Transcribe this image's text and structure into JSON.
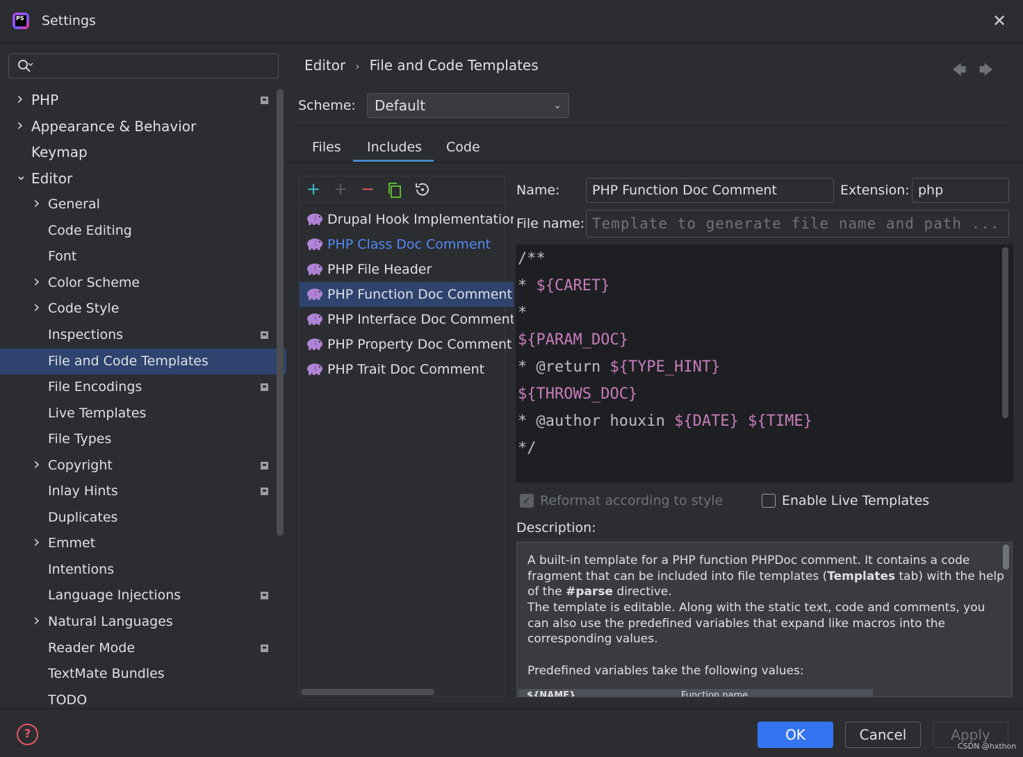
{
  "window": {
    "title": "Settings"
  },
  "search": {
    "placeholder": ""
  },
  "tree": [
    {
      "label": "PHP",
      "level": 0,
      "chevron": "right",
      "badge": true
    },
    {
      "label": "Appearance & Behavior",
      "level": 0,
      "chevron": "right",
      "badge": false
    },
    {
      "label": "Keymap",
      "level": 0,
      "chevron": "",
      "badge": false
    },
    {
      "label": "Editor",
      "level": 0,
      "chevron": "down",
      "badge": false
    },
    {
      "label": "General",
      "level": 1,
      "chevron": "right",
      "badge": false
    },
    {
      "label": "Code Editing",
      "level": 1,
      "chevron": "",
      "badge": false
    },
    {
      "label": "Font",
      "level": 1,
      "chevron": "",
      "badge": false
    },
    {
      "label": "Color Scheme",
      "level": 1,
      "chevron": "right",
      "badge": false
    },
    {
      "label": "Code Style",
      "level": 1,
      "chevron": "right",
      "badge": false
    },
    {
      "label": "Inspections",
      "level": 1,
      "chevron": "",
      "badge": true
    },
    {
      "label": "File and Code Templates",
      "level": 1,
      "chevron": "",
      "badge": false,
      "selected": true
    },
    {
      "label": "File Encodings",
      "level": 1,
      "chevron": "",
      "badge": true
    },
    {
      "label": "Live Templates",
      "level": 1,
      "chevron": "",
      "badge": false
    },
    {
      "label": "File Types",
      "level": 1,
      "chevron": "",
      "badge": false
    },
    {
      "label": "Copyright",
      "level": 1,
      "chevron": "right",
      "badge": true
    },
    {
      "label": "Inlay Hints",
      "level": 1,
      "chevron": "",
      "badge": true
    },
    {
      "label": "Duplicates",
      "level": 1,
      "chevron": "",
      "badge": false
    },
    {
      "label": "Emmet",
      "level": 1,
      "chevron": "right",
      "badge": false
    },
    {
      "label": "Intentions",
      "level": 1,
      "chevron": "",
      "badge": false
    },
    {
      "label": "Language Injections",
      "level": 1,
      "chevron": "",
      "badge": true
    },
    {
      "label": "Natural Languages",
      "level": 1,
      "chevron": "right",
      "badge": false
    },
    {
      "label": "Reader Mode",
      "level": 1,
      "chevron": "",
      "badge": true
    },
    {
      "label": "TextMate Bundles",
      "level": 1,
      "chevron": "",
      "badge": false
    },
    {
      "label": "TODO",
      "level": 1,
      "chevron": "",
      "badge": false
    }
  ],
  "breadcrumb": {
    "parent": "Editor",
    "separator": "›",
    "current": "File and Code Templates"
  },
  "nav": {
    "back": "🡄",
    "forward": "🡆"
  },
  "scheme": {
    "label": "Scheme:",
    "value": "Default"
  },
  "tabs": {
    "files": "Files",
    "includes": "Includes",
    "code": "Code"
  },
  "toolbar": {
    "add": "+",
    "add_disabled": "+",
    "remove": "−"
  },
  "templates": [
    {
      "name": "Drupal Hook Implementation",
      "color": "#dfe1e5"
    },
    {
      "name": "PHP Class Doc Comment",
      "color": "#548af7"
    },
    {
      "name": "PHP File Header",
      "color": "#dfe1e5"
    },
    {
      "name": "PHP Function Doc Comment",
      "color": "#dfe1e5",
      "selected": true
    },
    {
      "name": "PHP Interface Doc Comment",
      "color": "#dfe1e5"
    },
    {
      "name": "PHP Property Doc Comment",
      "color": "#dfe1e5"
    },
    {
      "name": "PHP Trait Doc Comment",
      "color": "#dfe1e5"
    }
  ],
  "form": {
    "name_label": "Name:",
    "name_value": "PHP Function Doc Comment",
    "ext_label": "Extension:",
    "ext_value": "php",
    "filename_label": "File name:",
    "filename_placeholder": "Template to generate file name and path ..."
  },
  "code": {
    "l1": "/**",
    "l2_prefix": "* ",
    "l2_var": "${CARET}",
    "l3": "*",
    "l4_var": "${PARAM_DOC}",
    "l5_prefix": "* @return ",
    "l5_var": "${TYPE_HINT}",
    "l6_var": "${THROWS_DOC}",
    "l7_prefix": "* @author houxin ",
    "l7_var1": "${DATE}",
    "l7_space": " ",
    "l7_var2": "${TIME}",
    "l8": "*/"
  },
  "options": {
    "reformat_label": "Reformat according to style",
    "reformat_checked": true,
    "live_label": "Enable Live Templates",
    "live_checked": false
  },
  "description": {
    "label": "Description:",
    "p1a": "A built-in template for a PHP function PHPDoc comment. It contains a code fragment that can be included into file templates (",
    "p1b": "Templates",
    "p1c": " tab) with the help of the ",
    "p1d": "#parse",
    "p1e": " directive.",
    "p2": "The template is editable. Along with the static text, code and comments, you can also use the predefined variables that expand like macros into the corresponding values.",
    "p3": "Predefined variables take the following values:",
    "table_var": "${NAME}",
    "table_desc": "Function name"
  },
  "footer": {
    "help": "?",
    "ok": "OK",
    "cancel": "Cancel",
    "apply": "Apply"
  },
  "watermark": "CSDN @hxthon",
  "colors": {
    "accent": "#3574f0",
    "selection": "#2e436e",
    "variable": "#c77dbb",
    "link": "#548af7",
    "add": "#3ac1ce",
    "remove": "#e55765"
  }
}
